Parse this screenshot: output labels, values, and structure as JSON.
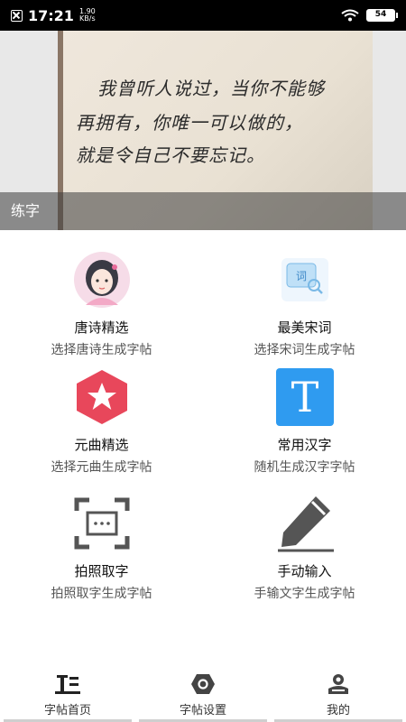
{
  "status_bar": {
    "time": "17:21",
    "speed_value": "1.90",
    "speed_unit": "KB/s",
    "battery": "54"
  },
  "banner": {
    "handwriting": [
      "我曾听人说过，当你不能够",
      "再拥有，你唯一可以做的，",
      "就是令自己不要忘记。"
    ],
    "caption": "练字"
  },
  "features": [
    {
      "title": "唐诗精选",
      "subtitle": "选择唐诗生成字帖",
      "icon": "girl-avatar-icon"
    },
    {
      "title": "最美宋词",
      "subtitle": "选择宋词生成字帖",
      "icon": "word-search-icon"
    },
    {
      "title": "元曲精选",
      "subtitle": "选择元曲生成字帖",
      "icon": "star-hexagon-icon"
    },
    {
      "title": "常用汉字",
      "subtitle": "随机生成汉字字帖",
      "icon": "letter-t-icon",
      "icon_text": "T"
    },
    {
      "title": "拍照取字",
      "subtitle": "拍照取字生成字帖",
      "icon": "scan-frame-icon"
    },
    {
      "title": "手动输入",
      "subtitle": "手输文字生成字帖",
      "icon": "pencil-icon"
    }
  ],
  "tabs": [
    {
      "label": "字帖首页",
      "icon": "text-format-icon"
    },
    {
      "label": "字帖设置",
      "icon": "settings-hex-icon"
    },
    {
      "label": "我的",
      "icon": "person-icon"
    }
  ],
  "colors": {
    "star_red": "#e8475b",
    "t_blue": "#2f9bf0",
    "dark_icon": "#555555"
  }
}
